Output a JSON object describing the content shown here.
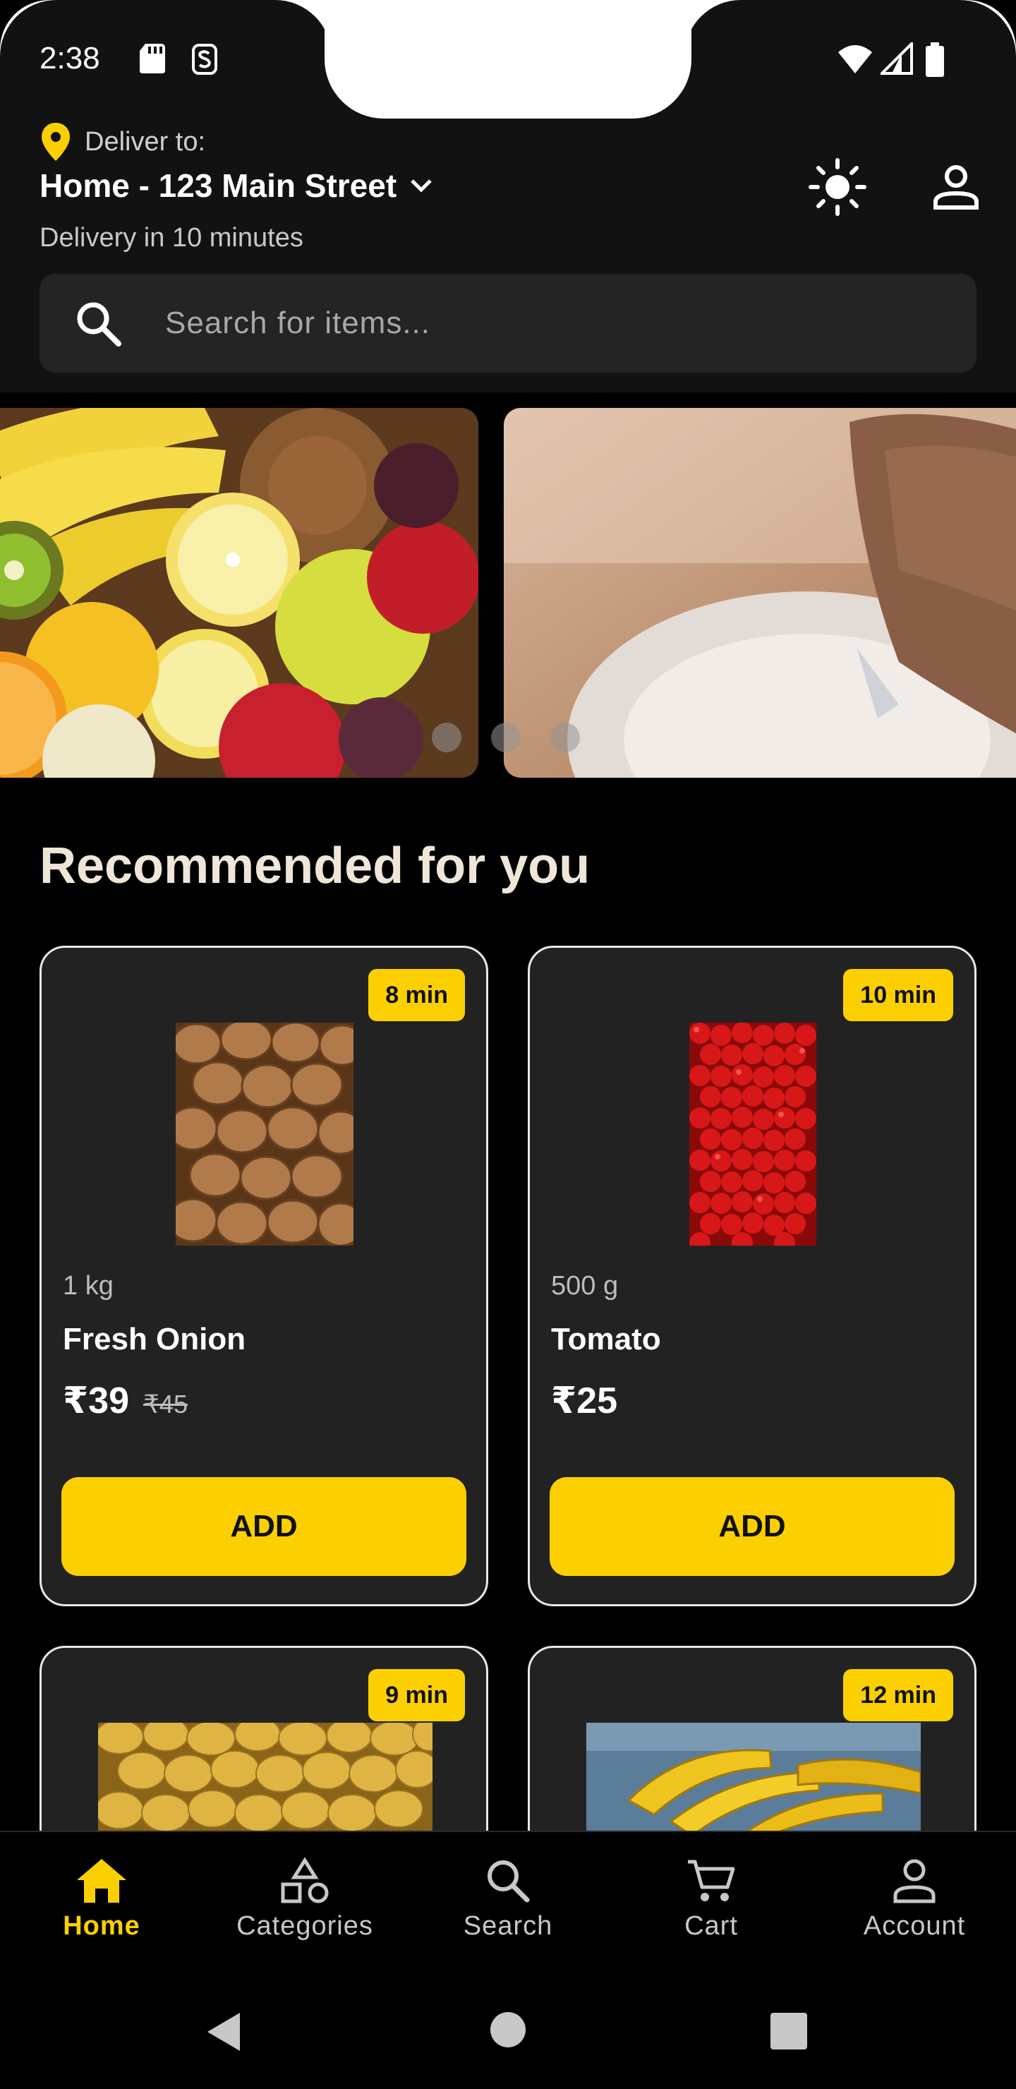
{
  "status": {
    "time": "2:38"
  },
  "header": {
    "deliver_label": "Deliver to:",
    "address": "Home - 123 Main Street",
    "eta": "Delivery in 10 minutes"
  },
  "search": {
    "placeholder": "Search for items..."
  },
  "banners": {
    "count": 3,
    "active": 0
  },
  "section": {
    "title": "Recommended for you"
  },
  "products": [
    {
      "badge": "8 min",
      "qty": "1 kg",
      "name": "Fresh Onion",
      "price": "₹39",
      "old_price": "₹45",
      "add": "ADD"
    },
    {
      "badge": "10 min",
      "qty": "500 g",
      "name": "Tomato",
      "price": "₹25",
      "old_price": "",
      "add": "ADD"
    },
    {
      "badge": "9 min"
    },
    {
      "badge": "12 min"
    }
  ],
  "nav": [
    {
      "label": "Home",
      "icon": "home-icon",
      "active": true
    },
    {
      "label": "Categories",
      "icon": "categories-icon"
    },
    {
      "label": "Search",
      "icon": "search-icon"
    },
    {
      "label": "Cart",
      "icon": "cart-icon"
    },
    {
      "label": "Account",
      "icon": "account-icon"
    }
  ],
  "colors": {
    "accent": "#FCD000",
    "bg": "#000000",
    "card": "#222222",
    "header": "#121212"
  }
}
